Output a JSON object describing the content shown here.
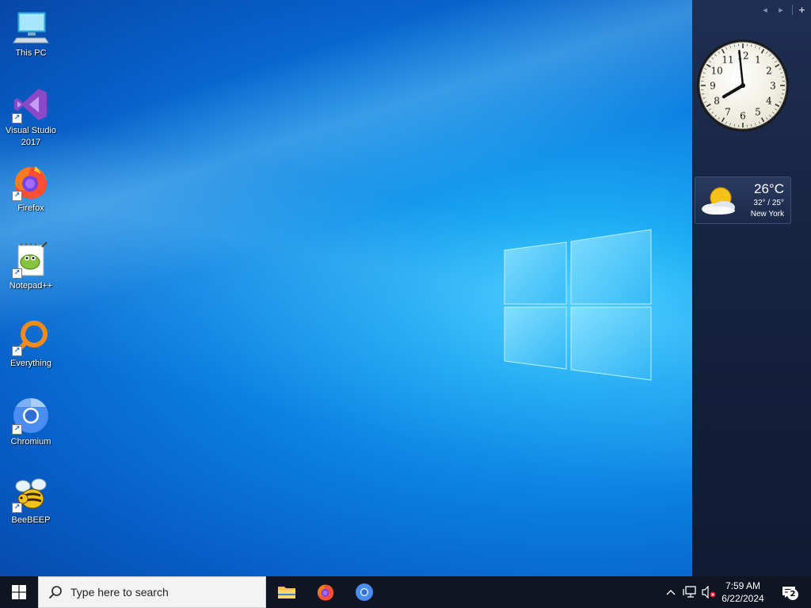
{
  "desktop": {
    "icons": [
      {
        "label": "This PC",
        "icon": "computer-icon"
      },
      {
        "label": "Visual Studio\n2017",
        "icon": "visual-studio-icon"
      },
      {
        "label": "Firefox",
        "icon": "firefox-icon"
      },
      {
        "label": "Notepad++",
        "icon": "notepadpp-icon"
      },
      {
        "label": "Everything",
        "icon": "everything-search-icon"
      },
      {
        "label": "Chromium",
        "icon": "chromium-icon"
      },
      {
        "label": "BeeBEEP",
        "icon": "beebeep-icon"
      }
    ]
  },
  "sidebar": {
    "controls": {
      "prev": "◂",
      "next": "▸",
      "add": "+"
    },
    "clock": {
      "hour": 7,
      "minute": 59,
      "numerals": [
        "12",
        "1",
        "2",
        "3",
        "4",
        "5",
        "6",
        "7",
        "8",
        "9",
        "10",
        "11"
      ]
    },
    "weather": {
      "temperature": "26°C",
      "range": "32° / 25°",
      "city": "New York",
      "condition": "partly-cloudy-icon"
    }
  },
  "taskbar": {
    "search_placeholder": "Type here to search",
    "pinned": [
      {
        "name": "File Explorer",
        "icon": "folder-icon"
      },
      {
        "name": "Firefox",
        "icon": "firefox-icon"
      },
      {
        "name": "Chromium",
        "icon": "chromium-icon"
      }
    ],
    "tray": {
      "time": "7:59 AM",
      "date": "6/22/2024",
      "notifications": "2"
    }
  },
  "colors": {
    "taskbar_bg": "#101522",
    "wallpaper_accent": "#1aa6f2",
    "sidebar_bg": "#1b2947"
  }
}
